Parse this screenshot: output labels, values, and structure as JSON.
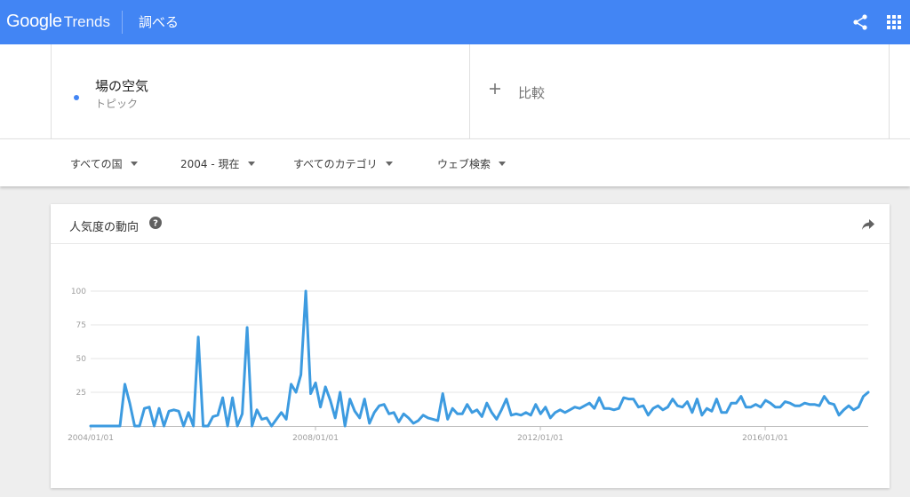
{
  "header": {
    "logo_google": "Google",
    "logo_trends": "Trends",
    "explore": "調べる",
    "icons": [
      "share-icon",
      "apps-icon"
    ]
  },
  "search": {
    "term": "場の空気",
    "term_type": "トピック",
    "compare_label": "比較",
    "term_color": "#4285f4"
  },
  "filters": {
    "country": "すべての国",
    "time_range": "2004 - 現在",
    "category": "すべてのカテゴリ",
    "search_type": "ウェブ検索"
  },
  "card": {
    "title": "人気度の動向",
    "icons": [
      "help-icon",
      "share-arrow-icon"
    ]
  },
  "colors": {
    "brand_blue": "#4285f4",
    "series_blue": "#3d9be0"
  },
  "chart_data": {
    "type": "line",
    "x_start": "2004-01",
    "x_end": "2017-11",
    "ylim": [
      0,
      100
    ],
    "y_ticks": [
      "100",
      "75",
      "50",
      "25"
    ],
    "x_ticks": [
      {
        "label": "2004/01/01",
        "x": "2004-01"
      },
      {
        "label": "2008/01/01",
        "x": "2008-01"
      },
      {
        "label": "2012/01/01",
        "x": "2012-01"
      },
      {
        "label": "2016/01/01",
        "x": "2016-01"
      }
    ],
    "grid": true,
    "series": [
      {
        "values": [
          0,
          0,
          0,
          0,
          0,
          0,
          0,
          31,
          17,
          0,
          0,
          13,
          14,
          0,
          13,
          0,
          11,
          12,
          11,
          0,
          10,
          0,
          66,
          0,
          0,
          7,
          8,
          21,
          0,
          21,
          0,
          9,
          73,
          0,
          12,
          5,
          6,
          0,
          5,
          10,
          5,
          31,
          25,
          38,
          100,
          24,
          32,
          14,
          29,
          19,
          6,
          25,
          0,
          20,
          11,
          6,
          20,
          2,
          10,
          15,
          16,
          9,
          10,
          3,
          9,
          6,
          2,
          4,
          8,
          6,
          5,
          4,
          24,
          5,
          13,
          9,
          9,
          16,
          10,
          12,
          7,
          17,
          10,
          5,
          12,
          20,
          8,
          9,
          8,
          10,
          8,
          16,
          9,
          14,
          6,
          10,
          12,
          10,
          12,
          14,
          13,
          15,
          17,
          13,
          21,
          13,
          13,
          12,
          13,
          21,
          20,
          20,
          14,
          15,
          8,
          13,
          15,
          12,
          14,
          20,
          15,
          14,
          18,
          10,
          20,
          8,
          13,
          11,
          20,
          10,
          10,
          17,
          17,
          22,
          14,
          14,
          16,
          14,
          19,
          17,
          14,
          14,
          18,
          17,
          15,
          15,
          17,
          16,
          16,
          15,
          22,
          17,
          16,
          8,
          12,
          15,
          12,
          14,
          22,
          25
        ]
      }
    ]
  }
}
